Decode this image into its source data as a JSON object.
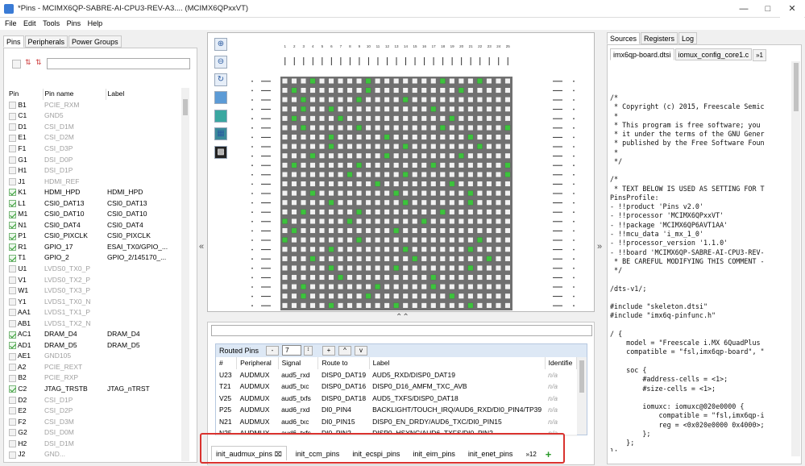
{
  "window": {
    "title": "*Pins - MCIMX6QP-SABRE-AI-CPU3-REV-A3.... (MCIMX6QPxxVT)"
  },
  "menu": [
    "File",
    "Edit",
    "Tools",
    "Pins",
    "Help"
  ],
  "left_tabs": [
    "Pins",
    "Peripherals",
    "Power Groups"
  ],
  "pins_columns": [
    "Pin",
    "Pin name",
    "Label"
  ],
  "pins": [
    {
      "pin": "B1",
      "name": "PCIE_RXM",
      "label": "",
      "checked": false
    },
    {
      "pin": "C1",
      "name": "GND5",
      "label": "",
      "checked": false
    },
    {
      "pin": "D1",
      "name": "CSI_D1M",
      "label": "",
      "checked": false
    },
    {
      "pin": "E1",
      "name": "CSI_D2M",
      "label": "",
      "checked": false
    },
    {
      "pin": "F1",
      "name": "CSI_D3P",
      "label": "",
      "checked": false
    },
    {
      "pin": "G1",
      "name": "DSI_D0P",
      "label": "",
      "checked": false
    },
    {
      "pin": "H1",
      "name": "DSI_D1P",
      "label": "",
      "checked": false
    },
    {
      "pin": "J1",
      "name": "HDMI_REF",
      "label": "",
      "checked": false
    },
    {
      "pin": "K1",
      "name": "HDMI_HPD",
      "label": "HDMI_HPD",
      "checked": true
    },
    {
      "pin": "L1",
      "name": "CSI0_DAT13",
      "label": "CSI0_DAT13",
      "checked": true
    },
    {
      "pin": "M1",
      "name": "CSI0_DAT10",
      "label": "CSI0_DAT10",
      "checked": true
    },
    {
      "pin": "N1",
      "name": "CSI0_DAT4",
      "label": "CSI0_DAT4",
      "checked": true
    },
    {
      "pin": "P1",
      "name": "CSI0_PIXCLK",
      "label": "CSI0_PIXCLK",
      "checked": true
    },
    {
      "pin": "R1",
      "name": "GPIO_17",
      "label": "ESAI_TX0/GPIO_...",
      "checked": true
    },
    {
      "pin": "T1",
      "name": "GPIO_2",
      "label": "GPIO_2/145170_...",
      "checked": true
    },
    {
      "pin": "U1",
      "name": "LVDS0_TX0_P",
      "label": "",
      "checked": false
    },
    {
      "pin": "V1",
      "name": "LVDS0_TX2_P",
      "label": "",
      "checked": false
    },
    {
      "pin": "W1",
      "name": "LVDS0_TX3_P",
      "label": "",
      "checked": false
    },
    {
      "pin": "Y1",
      "name": "LVDS1_TX0_N",
      "label": "",
      "checked": false
    },
    {
      "pin": "AA1",
      "name": "LVDS1_TX1_P",
      "label": "",
      "checked": false
    },
    {
      "pin": "AB1",
      "name": "LVDS1_TX2_N",
      "label": "",
      "checked": false
    },
    {
      "pin": "AC1",
      "name": "DRAM_D4",
      "label": "DRAM_D4",
      "checked": true
    },
    {
      "pin": "AD1",
      "name": "DRAM_D5",
      "label": "DRAM_D5",
      "checked": true
    },
    {
      "pin": "AE1",
      "name": "GND105",
      "label": "",
      "checked": false
    },
    {
      "pin": "A2",
      "name": "PCIE_REXT",
      "label": "",
      "checked": false
    },
    {
      "pin": "B2",
      "name": "PCIE_RXP",
      "label": "",
      "checked": false
    },
    {
      "pin": "C2",
      "name": "JTAG_TRSTB",
      "label": "JTAG_nTRST",
      "checked": true
    },
    {
      "pin": "D2",
      "name": "CSI_D1P",
      "label": "",
      "checked": false
    },
    {
      "pin": "E2",
      "name": "CSI_D2P",
      "label": "",
      "checked": false
    },
    {
      "pin": "F2",
      "name": "CSI_D3M",
      "label": "",
      "checked": false
    },
    {
      "pin": "G2",
      "name": "DSI_D0M",
      "label": "",
      "checked": false
    },
    {
      "pin": "H2",
      "name": "DSI_D1M",
      "label": "",
      "checked": false
    },
    {
      "pin": "J2",
      "name": "GND...",
      "label": "",
      "checked": false
    }
  ],
  "pkg_top_labels": [
    "1",
    "2",
    "3",
    "4",
    "5",
    "6",
    "7",
    "8",
    "9",
    "10",
    "11",
    "12",
    "13",
    "14",
    "15",
    "16",
    "17",
    "18",
    "19",
    "20",
    "21",
    "22",
    "23",
    "24",
    "25"
  ],
  "routed": {
    "title": "Routed Pins",
    "count": "7",
    "btn_minus": "-",
    "btn_plus": "+",
    "btn_up": "^",
    "btn_down": "v",
    "columns": [
      "#",
      "Peripheral",
      "Signal",
      "Route to",
      "Label",
      "Identifie"
    ],
    "rows": [
      [
        "U23",
        "AUDMUX",
        "aud5_rxd",
        "DISP0_DAT19",
        "AUD5_RXD/DISP0_DAT19",
        "n/a"
      ],
      [
        "T21",
        "AUDMUX",
        "aud5_txc",
        "DISP0_DAT16",
        "DISP0_D16_AMFM_TXC_AVB",
        "n/a"
      ],
      [
        "V25",
        "AUDMUX",
        "aud5_txfs",
        "DISP0_DAT18",
        "AUD5_TXFS/DISP0_DAT18",
        "n/a"
      ],
      [
        "P25",
        "AUDMUX",
        "aud6_rxd",
        "DI0_PIN4",
        "BACKLIGHT/TOUCH_IRQ/AUD6_RXD/DI0_PIN4/TP39",
        "n/a"
      ],
      [
        "N21",
        "AUDMUX",
        "aud6_txc",
        "DI0_PIN15",
        "DISP0_EN_DRDY/AUD6_TXC/DI0_PIN15",
        "n/a"
      ],
      [
        "N25",
        "AUDMUX",
        "aud6_txfs",
        "DI0_PIN2",
        "DISP0_HSYNC/AUD6_TXFS/DI0_PIN2",
        "n/a"
      ]
    ]
  },
  "bottom_tabs": [
    "init_audmux_pins",
    "init_ccm_pins",
    "init_ecspi_pins",
    "init_eim_pins",
    "init_enet_pins"
  ],
  "bottom_more": "»12",
  "right_tabs": [
    "Sources",
    "Registers",
    "Log"
  ],
  "editor_tabs": [
    "imx6qp-board.dtsi",
    "iomux_config_core1.c",
    "»1"
  ],
  "code": "/*\n * Copyright (c) 2015, Freescale Semic\n *\n * This program is free software; you\n * it under the terms of the GNU Gener\n * published by the Free Software Foun\n *\n */\n\n/*\n * TEXT BELOW IS USED AS SETTING FOR T\nPinsProfile:\n- !!product 'Pins v2.0'\n- !!processor 'MCIMX6QPxxVT'\n- !!package 'MCIMX6QP6AVT1AA'\n- !!mcu_data 'i_mx_1_0'\n- !!processor_version '1.1.0'\n- !!board 'MCIMX6QP-SABRE-AI-CPU3-REV-\n * BE CAREFUL MODIFYING THIS COMMENT -\n */\n\n/dts-v1/;\n\n#include \"skeleton.dtsi\"\n#include \"imx6q-pinfunc.h\"\n\n/ {\n    model = \"Freescale i.MX 6QuadPlus\n    compatible = \"fsl,imx6qp-board\", \"\n\n    soc {\n        #address-cells = <1>;\n        #size-cells = <1>;\n\n        iomuxc: iomuxc@020e0000 {\n            compatible = \"fsl,imx6qp-i\n            reg = <0x020e0000 0x4000>;\n        };\n    };\n};",
  "colors": {
    "accent": "#0078d7",
    "routed_pin": "#3cc43c",
    "package_bg": "#707070",
    "highlight": "#d9322e"
  }
}
